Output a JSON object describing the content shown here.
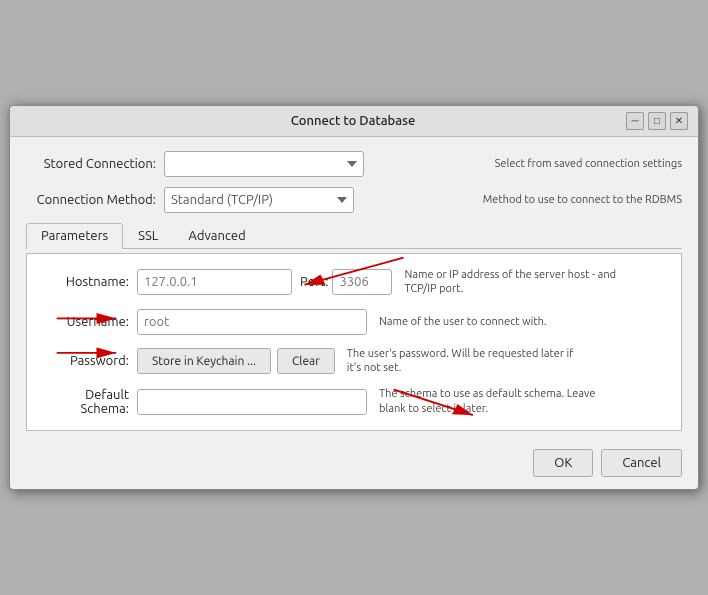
{
  "dialog": {
    "title": "Connect to Database",
    "title_btn_min": "─",
    "title_btn_max": "□",
    "title_btn_close": "✕"
  },
  "stored_connection": {
    "label": "Stored Connection:",
    "placeholder": "",
    "hint": "Select from saved connection settings"
  },
  "connection_method": {
    "label": "Connection Method:",
    "value": "Standard (TCP/IP)",
    "hint": "Method to use to connect to the RDBMS"
  },
  "tabs": [
    {
      "label": "Parameters",
      "active": true
    },
    {
      "label": "SSL",
      "active": false
    },
    {
      "label": "Advanced",
      "active": false
    }
  ],
  "params": {
    "hostname": {
      "label": "Hostname:",
      "placeholder": "127.0.0.1",
      "port_label": "Port:",
      "port_value": "3306",
      "hint": "Name or IP address of the server host - and TCP/IP port."
    },
    "username": {
      "label": "Username:",
      "placeholder": "root",
      "hint": "Name of the user to connect with."
    },
    "password": {
      "label": "Password:",
      "store_btn": "Store in Keychain ...",
      "clear_btn": "Clear",
      "hint": "The user's password. Will be requested later if it's not set."
    },
    "schema": {
      "label": "Default Schema:",
      "placeholder": "",
      "hint": "The schema to use as default schema. Leave blank to select it later."
    }
  },
  "footer": {
    "ok_label": "OK",
    "cancel_label": "Cancel"
  }
}
